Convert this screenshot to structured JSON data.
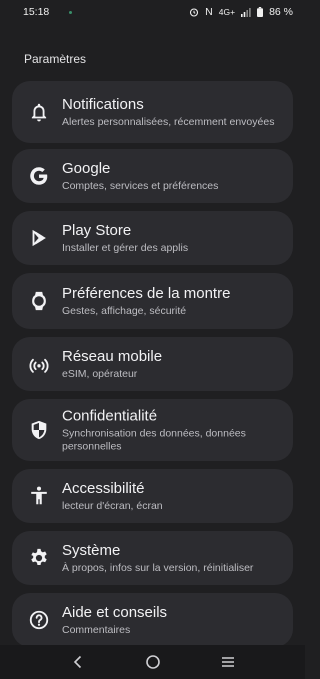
{
  "status_bar": {
    "time": "15:18",
    "network": "4G+",
    "nfc": "N",
    "battery": "86 %"
  },
  "section_title": "Paramètres",
  "items": [
    {
      "title": "Notifications",
      "subtitle": "Alertes personnalisées, récemment envoyées",
      "icon": "bell-icon"
    },
    {
      "title": "Google",
      "subtitle": "Comptes, services et préférences",
      "icon": "google-icon"
    },
    {
      "title": "Play Store",
      "subtitle": "Installer et gérer des applis",
      "icon": "play-store-icon"
    },
    {
      "title": "Préférences de la montre",
      "subtitle": "Gestes, affichage, sécurité",
      "icon": "watch-icon"
    },
    {
      "title": "Réseau mobile",
      "subtitle": "eSIM, opérateur",
      "icon": "cellular-icon"
    },
    {
      "title": "Confidentialité",
      "subtitle": "Synchronisation des données, données personnelles",
      "icon": "shield-icon"
    },
    {
      "title": "Accessibilité",
      "subtitle": "lecteur d'écran, écran",
      "icon": "accessibility-icon"
    },
    {
      "title": "Système",
      "subtitle": "À propos, infos sur la version, réinitialiser",
      "icon": "gear-icon"
    },
    {
      "title": "Aide et conseils",
      "subtitle": "Commentaires",
      "icon": "help-icon"
    }
  ],
  "nav": {
    "back": "back-icon",
    "home": "home-icon",
    "recents": "recents-icon"
  }
}
